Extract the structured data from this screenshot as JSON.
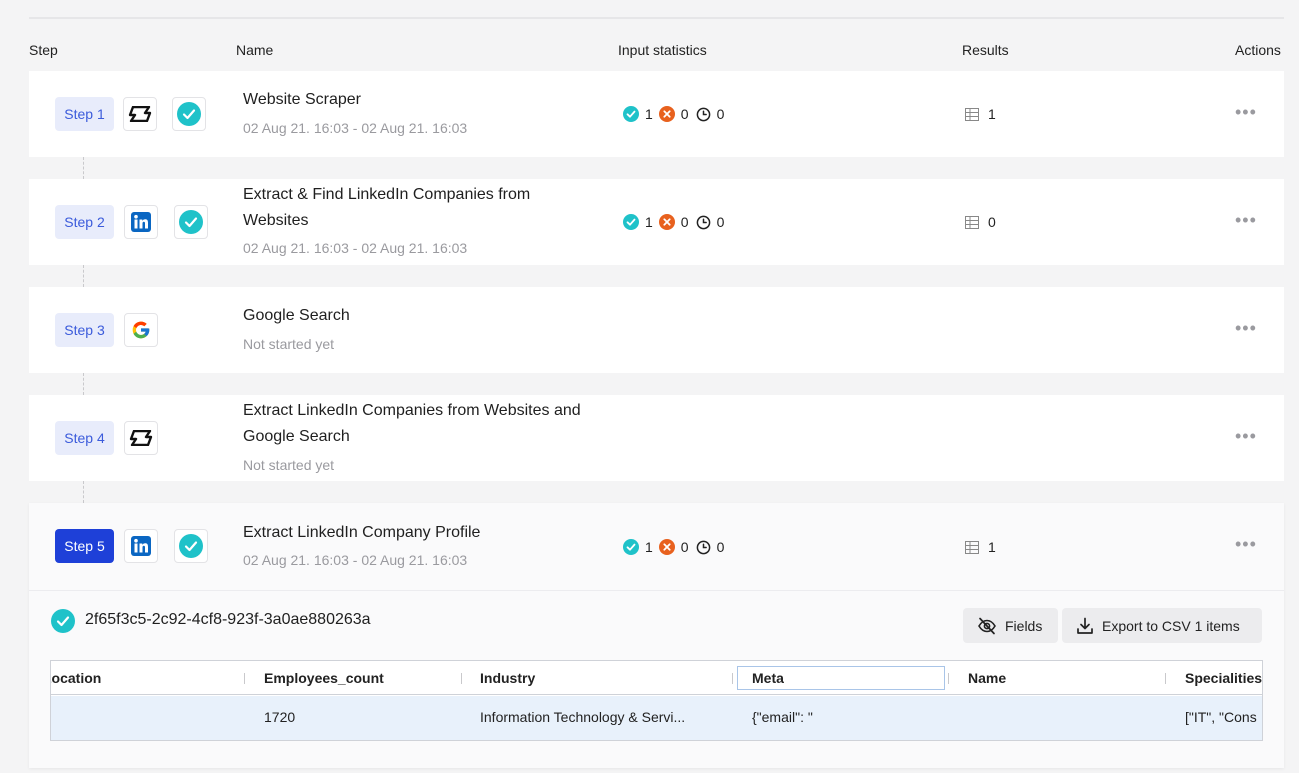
{
  "headers": {
    "step": "Step",
    "name": "Name",
    "input_statistics": "Input statistics",
    "results": "Results",
    "actions": "Actions"
  },
  "steps": [
    {
      "label": "Step 1",
      "icon": "phantom-logo-icon",
      "done": true,
      "title_lines": [
        "Website Scraper"
      ],
      "subtitle": "02 Aug 21. 16:03 - 02 Aug 21. 16:03",
      "stats": {
        "success": "1",
        "errors": "0",
        "pending": "0"
      },
      "result": "1"
    },
    {
      "label": "Step 2",
      "icon": "linkedin-logo-icon",
      "done": true,
      "title_lines": [
        "Extract & Find LinkedIn Companies from",
        "Websites"
      ],
      "subtitle": "02 Aug 21. 16:03 - 02 Aug 21. 16:03",
      "stats": {
        "success": "1",
        "errors": "0",
        "pending": "0"
      },
      "result": "0"
    },
    {
      "label": "Step 3",
      "icon": "google-logo-icon",
      "done": false,
      "title_lines": [
        "Google Search"
      ],
      "subtitle": "Not started yet"
    },
    {
      "label": "Step 4",
      "icon": "phantom-logo-icon",
      "done": false,
      "title_lines": [
        "Extract LinkedIn Companies from Websites and",
        "Google Search"
      ],
      "subtitle": "Not started yet"
    },
    {
      "label": "Step 5",
      "icon": "linkedin-logo-icon",
      "done": true,
      "active": true,
      "title_lines": [
        "Extract LinkedIn Company Profile"
      ],
      "subtitle": "02 Aug 21. 16:03 - 02 Aug 21. 16:03",
      "stats": {
        "success": "1",
        "errors": "0",
        "pending": "0"
      },
      "result": "1"
    }
  ],
  "actions_icon": "•••",
  "detail": {
    "run_id": "2f65f3c5-2c92-4cf8-923f-3a0ae880263a",
    "fields_button": "Fields",
    "export_button": "Export to CSV 1 items",
    "columns": [
      "Location",
      "Employees_count",
      "Industry",
      "Meta",
      "Name",
      "Specialities"
    ],
    "row": [
      "",
      "1720",
      "Information Technology & Servi...",
      "{\"email\": \"",
      "",
      "[\"IT\", \"Cons"
    ]
  },
  "colors": {
    "accent": "#1e40d8",
    "success": "#1fc2c9",
    "error": "#e8611e",
    "linkedin": "#0a66c2"
  }
}
